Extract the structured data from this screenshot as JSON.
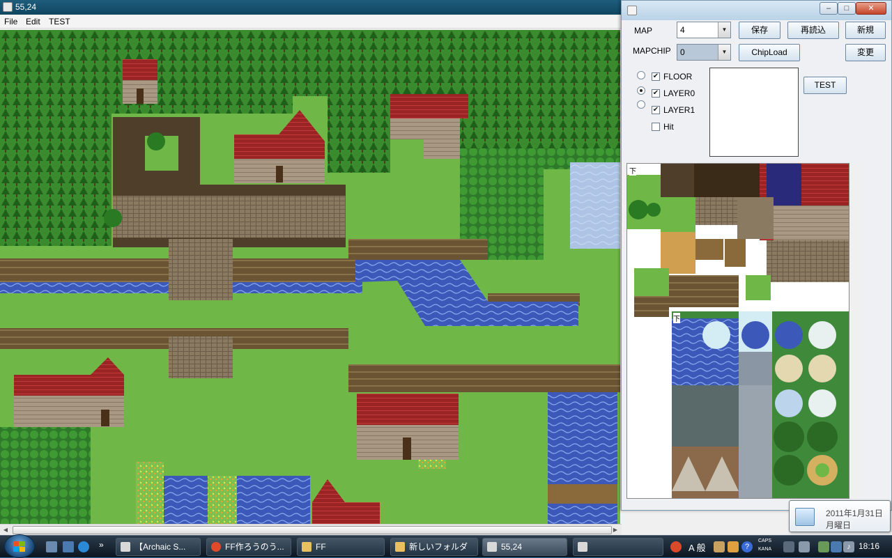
{
  "main_window": {
    "title": "55,24",
    "menu": [
      "File",
      "Edit",
      "TEST"
    ]
  },
  "panel": {
    "map_label": "MAP",
    "map_value": "4",
    "mapchip_label": "MAPCHIP",
    "mapchip_value": "0",
    "buttons": {
      "save": "保存",
      "reload": "再読込",
      "new": "新規",
      "chipload": "ChipLoad",
      "change": "変更",
      "test": "TEST"
    },
    "layers": [
      {
        "label": "FLOOR",
        "checked": true,
        "selected": false
      },
      {
        "label": "LAYER0",
        "checked": true,
        "selected": true
      },
      {
        "label": "LAYER1",
        "checked": true,
        "selected": false
      }
    ],
    "hit_label": "Hit",
    "chipset_labels": [
      "下",
      "下"
    ]
  },
  "taskbar": {
    "tasks": [
      {
        "label": "【Archaic S...",
        "color": "#d8d8d8"
      },
      {
        "label": "FF作ろうのう...",
        "color": "#e04a2a"
      },
      {
        "label": "FF",
        "color": "#e8c060"
      },
      {
        "label": "新しいフォルダ",
        "color": "#e8c060"
      },
      {
        "label": "55,24",
        "color": "#d8d8d8"
      },
      {
        "label": "",
        "color": "#d8d8d8"
      }
    ],
    "ime": "A 般",
    "caps": "CAPS",
    "kana": "KANA",
    "clock": "18:16"
  },
  "date_tooltip": {
    "line1": "2011年1月31日",
    "line2": "月曜日"
  },
  "colors": {
    "grass": "#6fb848",
    "tree": "#2f7a2a",
    "water": "#4a6ac8",
    "dirt": "#5a4a32",
    "roof": "#a82a2a",
    "wall": "#9a8a78"
  }
}
